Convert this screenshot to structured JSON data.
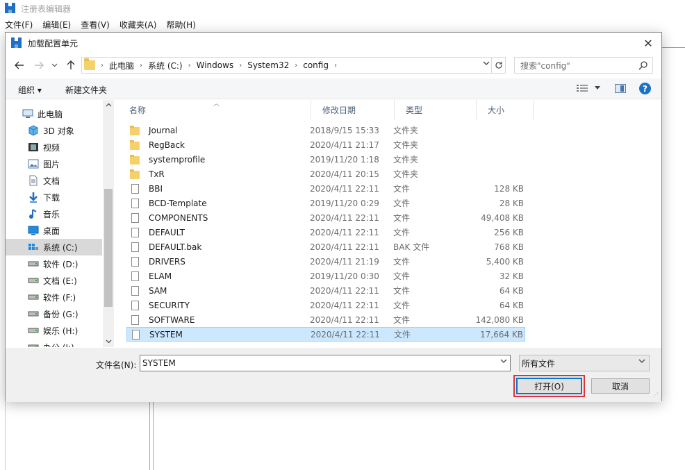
{
  "app": {
    "title": "注册表编辑器",
    "menu": [
      "文件(F)",
      "编辑(E)",
      "查看(V)",
      "收藏夹(A)",
      "帮助(H)"
    ]
  },
  "dialog": {
    "title": "加载配置单元",
    "close_glyph": "✕"
  },
  "address": {
    "breadcrumbs": [
      "此电脑",
      "系统 (C:)",
      "Windows",
      "System32",
      "config"
    ],
    "search_placeholder": "搜索\"config\""
  },
  "toolbar": {
    "organize": "组织 ▾",
    "new_folder": "新建文件夹"
  },
  "nav_tree": [
    {
      "label": "此电脑",
      "icon": "computer-icon",
      "indent": 0,
      "selected": false
    },
    {
      "label": "3D 对象",
      "icon": "cube-icon",
      "indent": 1,
      "selected": false
    },
    {
      "label": "视频",
      "icon": "video-icon",
      "indent": 1,
      "selected": false
    },
    {
      "label": "图片",
      "icon": "picture-icon",
      "indent": 1,
      "selected": false
    },
    {
      "label": "文档",
      "icon": "document-icon",
      "indent": 1,
      "selected": false
    },
    {
      "label": "下载",
      "icon": "download-icon",
      "indent": 1,
      "selected": false
    },
    {
      "label": "音乐",
      "icon": "music-icon",
      "indent": 1,
      "selected": false
    },
    {
      "label": "桌面",
      "icon": "desktop-icon",
      "indent": 1,
      "selected": false
    },
    {
      "label": "系统 (C:)",
      "icon": "system-drive-icon",
      "indent": 1,
      "selected": true
    },
    {
      "label": "软件 (D:)",
      "icon": "drive-icon",
      "indent": 1,
      "selected": false
    },
    {
      "label": "文档 (E:)",
      "icon": "drive-icon",
      "indent": 1,
      "selected": false
    },
    {
      "label": "软件 (F:)",
      "icon": "drive-icon",
      "indent": 1,
      "selected": false
    },
    {
      "label": "备份 (G:)",
      "icon": "drive-icon",
      "indent": 1,
      "selected": false
    },
    {
      "label": "娱乐 (H:)",
      "icon": "drive-icon",
      "indent": 1,
      "selected": false
    },
    {
      "label": "办公 (I:)",
      "icon": "drive-icon",
      "indent": 1,
      "selected": false
    }
  ],
  "columns": [
    "名称",
    "修改日期",
    "类型",
    "大小"
  ],
  "files": [
    {
      "name": "Journal",
      "date": "2018/9/15 15:33",
      "type": "文件夹",
      "size": "",
      "kind": "folder"
    },
    {
      "name": "RegBack",
      "date": "2020/4/11 21:17",
      "type": "文件夹",
      "size": "",
      "kind": "folder"
    },
    {
      "name": "systemprofile",
      "date": "2019/11/20 1:18",
      "type": "文件夹",
      "size": "",
      "kind": "folder"
    },
    {
      "name": "TxR",
      "date": "2020/4/11 20:15",
      "type": "文件夹",
      "size": "",
      "kind": "folder"
    },
    {
      "name": "BBI",
      "date": "2020/4/11 22:11",
      "type": "文件",
      "size": "128 KB",
      "kind": "file"
    },
    {
      "name": "BCD-Template",
      "date": "2019/11/20 0:29",
      "type": "文件",
      "size": "28 KB",
      "kind": "file"
    },
    {
      "name": "COMPONENTS",
      "date": "2020/4/11 22:11",
      "type": "文件",
      "size": "49,408 KB",
      "kind": "file"
    },
    {
      "name": "DEFAULT",
      "date": "2020/4/11 22:11",
      "type": "文件",
      "size": "256 KB",
      "kind": "file"
    },
    {
      "name": "DEFAULT.bak",
      "date": "2020/4/11 22:11",
      "type": "BAK 文件",
      "size": "768 KB",
      "kind": "file"
    },
    {
      "name": "DRIVERS",
      "date": "2020/4/11 21:19",
      "type": "文件",
      "size": "5,400 KB",
      "kind": "file"
    },
    {
      "name": "ELAM",
      "date": "2019/11/20 0:30",
      "type": "文件",
      "size": "32 KB",
      "kind": "file"
    },
    {
      "name": "SAM",
      "date": "2020/4/11 22:11",
      "type": "文件",
      "size": "64 KB",
      "kind": "file"
    },
    {
      "name": "SECURITY",
      "date": "2020/4/11 22:11",
      "type": "文件",
      "size": "64 KB",
      "kind": "file"
    },
    {
      "name": "SOFTWARE",
      "date": "2020/4/11 22:11",
      "type": "文件",
      "size": "142,080 KB",
      "kind": "file"
    },
    {
      "name": "SYSTEM",
      "date": "2020/4/11 22:11",
      "type": "文件",
      "size": "17,664 KB",
      "kind": "file",
      "selected": true
    }
  ],
  "bottom": {
    "filename_label": "文件名(N):",
    "filename_value": "SYSTEM",
    "filter_value": "所有文件",
    "open_button": "打开(O)",
    "cancel_button": "取消"
  },
  "colors": {
    "selection_bg": "#cce8ff",
    "selection_border": "#99d1ff",
    "highlight_red": "#e0323b",
    "primary_blue": "#0078d7"
  }
}
